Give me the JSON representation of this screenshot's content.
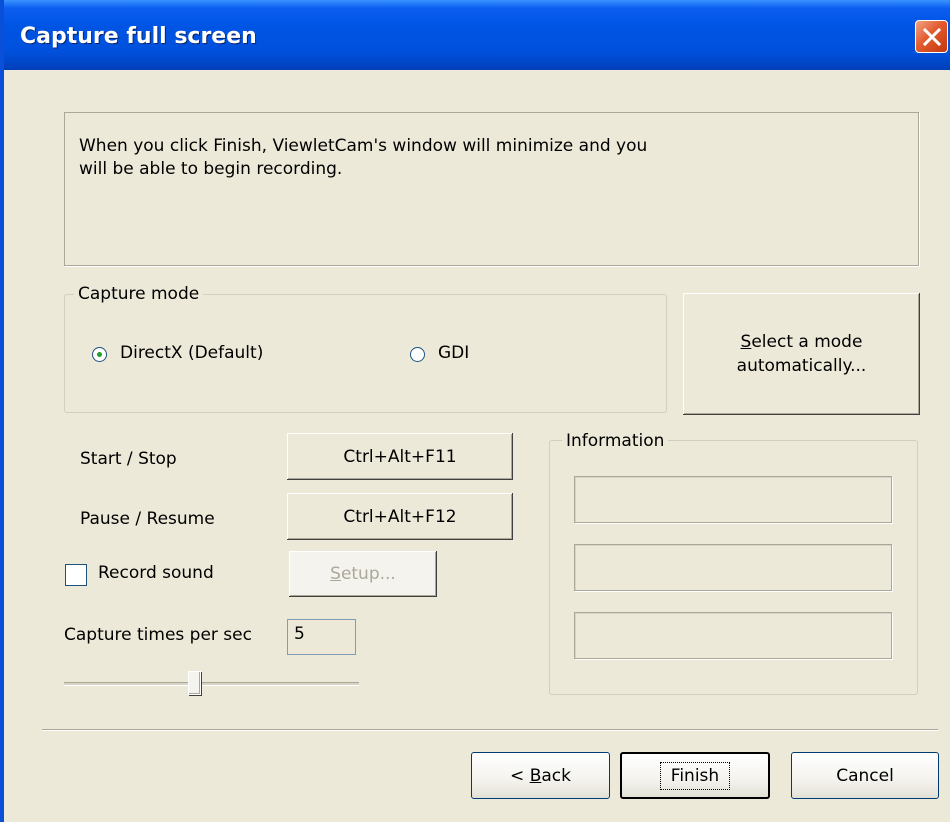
{
  "window": {
    "title": "Capture full screen"
  },
  "info": {
    "message_line1": "When you click Finish, ViewletCam's window will minimize and you",
    "message_line2": "will be able to begin recording."
  },
  "capture_mode": {
    "legend": "Capture mode",
    "options": [
      {
        "label": "DirectX (Default)",
        "checked": true
      },
      {
        "label": "GDI",
        "checked": false
      }
    ],
    "auto_button": {
      "line1_rest": "elect a mode",
      "line1_mnemonic": "S",
      "line2": "automatically..."
    }
  },
  "hotkeys": {
    "start_stop_label": "Start / Stop",
    "start_stop_value": "Ctrl+Alt+F11",
    "pause_resume_label": "Pause / Resume",
    "pause_resume_value": "Ctrl+Alt+F12"
  },
  "sound": {
    "record_label": "Record sound",
    "checked": false,
    "setup_mnemonic": "S",
    "setup_rest": "etup..."
  },
  "rate": {
    "label": "Capture times per sec",
    "value": "5",
    "slider_fraction": 0.44
  },
  "information": {
    "legend": "Information",
    "fields": [
      "",
      "",
      ""
    ]
  },
  "footer": {
    "back_prefix": "< ",
    "back_mnemonic": "B",
    "back_rest": "ack",
    "finish_label": "Finish",
    "cancel_label": "Cancel"
  }
}
